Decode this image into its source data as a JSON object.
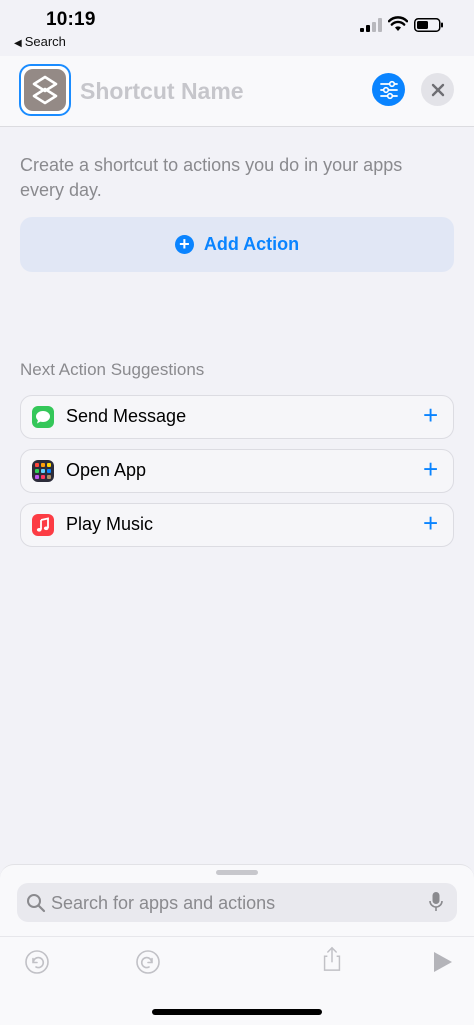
{
  "status_bar": {
    "time": "10:19",
    "back_label": "Search"
  },
  "header": {
    "name_placeholder": "Shortcut Name",
    "icons": {
      "app": "shortcuts-icon",
      "settings": "sliders-icon",
      "close": "close-icon"
    }
  },
  "main": {
    "intro_text": "Create a shortcut to actions you do in your apps every day.",
    "add_action_label": "Add Action",
    "suggestions_header": "Next Action Suggestions",
    "suggestions": [
      {
        "label": "Send Message",
        "icon": "messages-icon"
      },
      {
        "label": "Open App",
        "icon": "app-grid-icon"
      },
      {
        "label": "Play Music",
        "icon": "music-icon"
      }
    ]
  },
  "bottom": {
    "search_placeholder": "Search for apps and actions",
    "toolbar": [
      "undo-icon",
      "redo-icon",
      "share-icon",
      "play-icon"
    ]
  },
  "colors": {
    "accent": "#0a84ff",
    "background": "#f2f2f7",
    "secondary_text": "#8a8a8e",
    "messages_green": "#34c759",
    "music_red": "#fc3c44"
  }
}
